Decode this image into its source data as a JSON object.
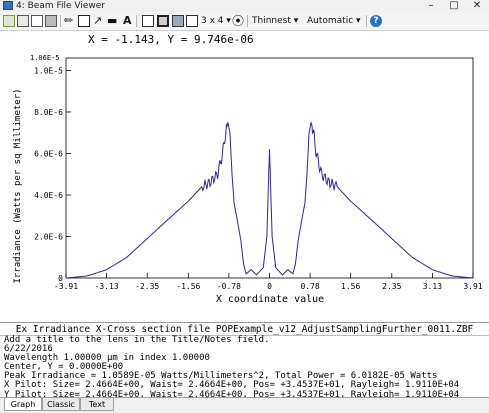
{
  "window": {
    "title": "4: Beam File Viewer"
  },
  "toolbar": {
    "grid_label": "3 x 4",
    "thinness_label": "Thinnest",
    "scale_label": "Automatic"
  },
  "readout": "X = -1.143, Y = 9.746e-06",
  "chart_data": {
    "type": "line",
    "xlabel": "X coordinate value",
    "ylabel": "Irradiance (Watts per sq Millimeter)",
    "xlim": [
      -3.91,
      3.91
    ],
    "ylim": [
      0,
      1.06e-05
    ],
    "ymax_label": "1.06E-5",
    "x_ticks": [
      "-3.91",
      "-3.13",
      "-2.35",
      "-1.56",
      "-0.78",
      "0",
      "0.78",
      "1.56",
      "2.35",
      "3.13",
      "3.91"
    ],
    "y_ticks": [
      "0",
      "2.0E-6",
      "4.0E-6",
      "6.0E-6",
      "8.0E-6",
      "1.0E-5"
    ],
    "grid": false,
    "line_color": "#2b2b8a",
    "series": [
      {
        "points": [
          [
            -3.91,
            0.0
          ],
          [
            -3.5,
            1e-07
          ],
          [
            -3.13,
            4e-07
          ],
          [
            -2.74,
            1e-06
          ],
          [
            -2.35,
            1.9e-06
          ],
          [
            -1.96,
            2.8e-06
          ],
          [
            -1.56,
            3.7e-06
          ],
          [
            -1.3,
            4.4e-06
          ],
          [
            -1.143,
            4.6e-06
          ],
          [
            -1.0,
            5e-06
          ],
          [
            -0.9,
            6e-06
          ],
          [
            -0.85,
            6.9e-06
          ],
          [
            -0.8,
            7.5e-06
          ],
          [
            -0.76,
            7e-06
          ],
          [
            -0.72,
            5e-06
          ],
          [
            -0.68,
            3.6e-06
          ],
          [
            -0.62,
            2.8e-06
          ],
          [
            -0.55,
            1.8e-06
          ],
          [
            -0.5,
            7e-07
          ],
          [
            -0.45,
            2e-07
          ],
          [
            -0.35,
            4e-07
          ],
          [
            -0.25,
            1.5e-07
          ],
          [
            -0.12,
            5e-07
          ],
          [
            -0.05,
            2e-06
          ],
          [
            0.0,
            6.2e-06
          ],
          [
            0.05,
            2e-06
          ],
          [
            0.12,
            5e-07
          ],
          [
            0.25,
            1.5e-07
          ],
          [
            0.35,
            4e-07
          ],
          [
            0.45,
            2e-07
          ],
          [
            0.5,
            7e-07
          ],
          [
            0.55,
            1.8e-06
          ],
          [
            0.62,
            2.8e-06
          ],
          [
            0.68,
            3.6e-06
          ],
          [
            0.72,
            5e-06
          ],
          [
            0.76,
            7e-06
          ],
          [
            0.8,
            7.5e-06
          ],
          [
            0.85,
            6.9e-06
          ],
          [
            0.9,
            6e-06
          ],
          [
            1.0,
            5e-06
          ],
          [
            1.143,
            4.6e-06
          ],
          [
            1.3,
            4.4e-06
          ],
          [
            1.56,
            3.7e-06
          ],
          [
            1.96,
            2.8e-06
          ],
          [
            2.35,
            1.9e-06
          ],
          [
            2.74,
            1e-06
          ],
          [
            3.13,
            4e-07
          ],
          [
            3.5,
            1e-07
          ],
          [
            3.91,
            0.0
          ]
        ]
      }
    ]
  },
  "caption": "Ex Irradiance X-Cross section file POPExample_v12_AdjustSamplingFurther_0011.ZBF",
  "info_lines": [
    "Add a title to the lens in the Title/Notes field.",
    "6/22/2016",
    "Wavelength 1.00000 µm in index 1.00000",
    "Center, Y = 0.0000E+00",
    "Peak Irradiance = 1.0589E-05 Watts/Millimeters^2, Total Power = 6.0182E-05 Watts",
    "X Pilot: Size= 2.4664E+00, Waist= 2.4664E+00, Pos= +3.4537E+01, Rayleigh= 1.9110E+04",
    "Y Pilot: Size= 2.4664E+00, Waist= 2.4664E+00, Pos= +3.4537E+01, Rayleigh= 1.9110E+04"
  ],
  "tabs": [
    "Graph",
    "Classic",
    "Text"
  ]
}
